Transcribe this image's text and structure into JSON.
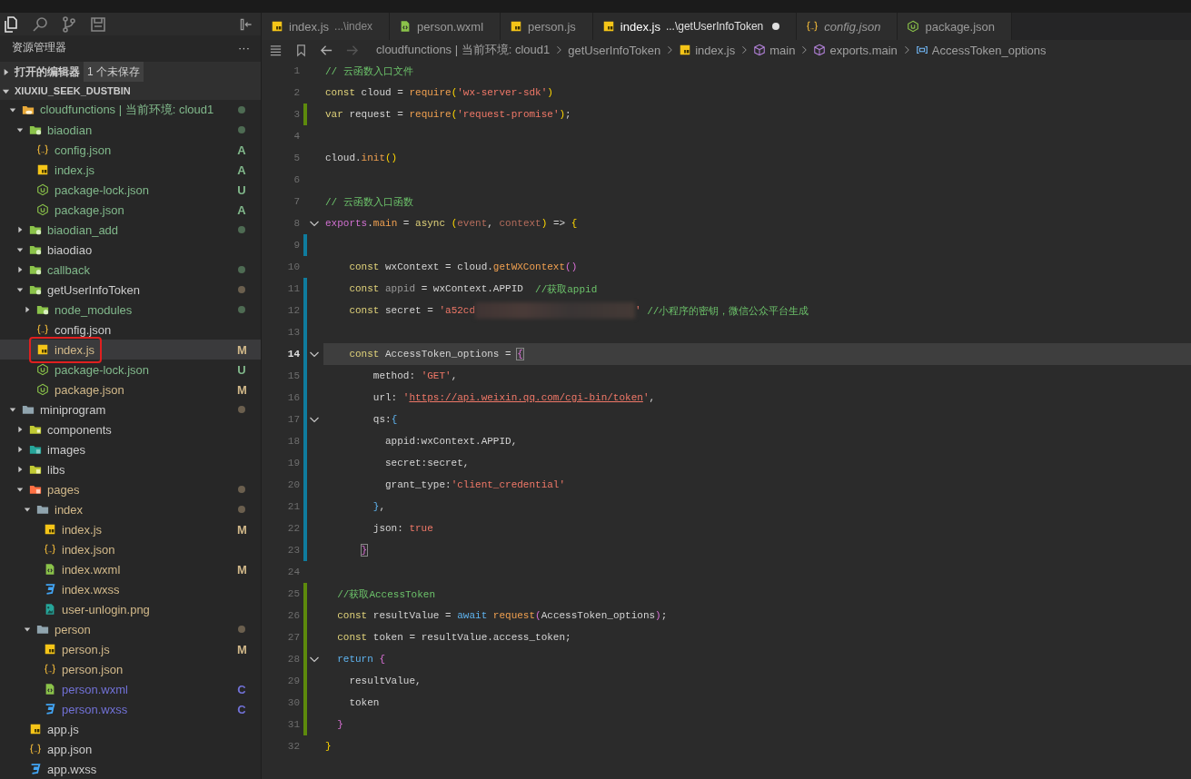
{
  "activity": [
    {
      "kind": "files",
      "selected": true
    },
    {
      "kind": "search",
      "selected": false
    },
    {
      "kind": "source-control",
      "selected": false
    },
    {
      "kind": "storage",
      "selected": false
    }
  ],
  "sidebar": {
    "title": "资源管理器",
    "more": "···",
    "open_editors": {
      "label": "打开的编辑器",
      "badge": "1 个未保存",
      "expanded": false
    },
    "project": {
      "label": "XIUXIU_SEEK_DUSTBIN",
      "expanded": true
    },
    "tree": [
      {
        "name": "cloudfunctions | 当前环境: cloud1",
        "kind": "folder-cloud",
        "color": "#81b88b",
        "dot": {
          "color": "#4e6b53"
        },
        "expanded": true,
        "selected": false,
        "children": [
          {
            "name": "biaodian",
            "kind": "folder-green",
            "color": "#81b88b",
            "dot": {
              "color": "#4e6b53"
            },
            "expanded": true,
            "selected": false,
            "children": [
              {
                "name": "config.json",
                "kind": "json",
                "color": "#81b88b",
                "badge": "A",
                "selected": false
              },
              {
                "name": "index.js",
                "kind": "js",
                "color": "#81b88b",
                "badge": "A",
                "selected": false
              },
              {
                "name": "package-lock.json",
                "kind": "node",
                "color": "#81b88b",
                "badge": "U",
                "selected": false
              },
              {
                "name": "package.json",
                "kind": "node",
                "color": "#81b88b",
                "badge": "A",
                "selected": false
              }
            ]
          },
          {
            "name": "biaodian_add",
            "kind": "folder-green",
            "color": "#81b88b",
            "dot": {
              "color": "#4e6b53"
            },
            "expanded": false,
            "selected": false
          },
          {
            "name": "biaodiao",
            "kind": "folder-green",
            "color": "#cccccc",
            "expanded": true,
            "selected": false
          },
          {
            "name": "callback",
            "kind": "folder-green",
            "color": "#81b88b",
            "dot": {
              "color": "#4e6b53"
            },
            "expanded": false,
            "selected": false
          },
          {
            "name": "getUserInfoToken",
            "kind": "folder-green",
            "color": "#cccccc",
            "dot": {
              "color": "#6b5f4e"
            },
            "expanded": true,
            "selected": false,
            "children": [
              {
                "name": "node_modules",
                "kind": "folder-green",
                "color": "#81b88b",
                "dot": {
                  "color": "#4e6b53"
                },
                "expanded": false,
                "selected": false
              },
              {
                "name": "config.json",
                "kind": "json",
                "color": "#cccccc",
                "selected": false
              },
              {
                "name": "index.js",
                "kind": "js",
                "color": "#d2b98a",
                "badge": "M",
                "selected": true
              },
              {
                "name": "package-lock.json",
                "kind": "node",
                "color": "#81b88b",
                "badge": "U",
                "selected": false
              },
              {
                "name": "package.json",
                "kind": "node",
                "color": "#d2b98a",
                "badge": "M",
                "selected": false
              }
            ]
          }
        ]
      },
      {
        "name": "miniprogram",
        "kind": "folder-grey",
        "color": "#cccccc",
        "dot": {
          "color": "#6b5f4e"
        },
        "expanded": true,
        "selected": false,
        "children": [
          {
            "name": "components",
            "kind": "folder-components",
            "color": "#cccccc",
            "expanded": false,
            "selected": false
          },
          {
            "name": "images",
            "kind": "folder-images",
            "color": "#cccccc",
            "expanded": false,
            "selected": false
          },
          {
            "name": "libs",
            "kind": "folder-libs",
            "color": "#cccccc",
            "expanded": false,
            "selected": false
          },
          {
            "name": "pages",
            "kind": "folder-pages",
            "color": "#d2b98a",
            "dot": {
              "color": "#6b5f4e"
            },
            "expanded": true,
            "selected": false,
            "children": [
              {
                "name": "index",
                "kind": "folder-grey",
                "color": "#d2b98a",
                "dot": {
                  "color": "#6b5f4e"
                },
                "expanded": true,
                "selected": false,
                "children": [
                  {
                    "name": "index.js",
                    "kind": "js",
                    "color": "#d2b98a",
                    "badge": "M",
                    "selected": false
                  },
                  {
                    "name": "index.json",
                    "kind": "json",
                    "color": "#d2b98a",
                    "selected": false
                  },
                  {
                    "name": "index.wxml",
                    "kind": "wxml",
                    "color": "#d2b98a",
                    "badge": "M",
                    "selected": false
                  },
                  {
                    "name": "index.wxss",
                    "kind": "wxss",
                    "color": "#d2b98a",
                    "selected": false
                  },
                  {
                    "name": "user-unlogin.png",
                    "kind": "image",
                    "color": "#d2b98a",
                    "selected": false
                  }
                ]
              },
              {
                "name": "person",
                "kind": "folder-grey",
                "color": "#d2b98a",
                "dot": {
                  "color": "#6b5f4e"
                },
                "expanded": true,
                "selected": false,
                "children": [
                  {
                    "name": "person.js",
                    "kind": "js",
                    "color": "#d2b98a",
                    "badge": "M",
                    "selected": false
                  },
                  {
                    "name": "person.json",
                    "kind": "json",
                    "color": "#d2b98a",
                    "selected": false
                  },
                  {
                    "name": "person.wxml",
                    "kind": "wxml",
                    "color": "#7171d6",
                    "badge": "C",
                    "selected": false
                  },
                  {
                    "name": "person.wxss",
                    "kind": "wxss",
                    "color": "#7171d6",
                    "badge": "C",
                    "selected": false
                  }
                ]
              }
            ]
          },
          {
            "name": "app.js",
            "kind": "js",
            "color": "#cccccc",
            "selected": false
          },
          {
            "name": "app.json",
            "kind": "json",
            "color": "#cccccc",
            "selected": false
          },
          {
            "name": "app.wxss",
            "kind": "wxss",
            "color": "#cccccc",
            "selected": false
          }
        ]
      }
    ]
  },
  "tabs": [
    {
      "label": "index.js",
      "path": "...\\index",
      "kind": "js",
      "selected": false,
      "dirty": false,
      "preview": false
    },
    {
      "label": "person.wxml",
      "kind": "wxml",
      "selected": false,
      "dirty": false,
      "preview": false
    },
    {
      "label": "person.js",
      "kind": "js",
      "selected": false,
      "dirty": false,
      "preview": false
    },
    {
      "label": "index.js",
      "path": "...\\getUserInfoToken",
      "kind": "js",
      "selected": true,
      "dirty": true,
      "preview": false
    },
    {
      "label": "config.json",
      "kind": "json",
      "selected": false,
      "dirty": false,
      "preview": true
    },
    {
      "label": "package.json",
      "kind": "node",
      "selected": false,
      "dirty": false,
      "preview": false
    }
  ],
  "nav": {
    "back_disabled": false,
    "forward_disabled": true
  },
  "breadcrumb": [
    {
      "label": "cloudfunctions | 当前环境: cloud1"
    },
    {
      "label": "getUserInfoToken"
    },
    {
      "label": "index.js",
      "kind": "js"
    },
    {
      "label": "main",
      "kind": "method"
    },
    {
      "label": "exports.main",
      "kind": "method"
    },
    {
      "label": "AccessToken_options",
      "kind": "field"
    }
  ],
  "lines": [
    {
      "number": "1",
      "current": false,
      "fold": false,
      "tokens": [
        {
          "kind": "comment",
          "text": "// 云函数入口文件"
        }
      ]
    },
    {
      "number": "2",
      "current": false,
      "fold": false,
      "tokens": [
        {
          "kind": "kw",
          "text": "const"
        },
        {
          "kind": "plain",
          "text": " cloud = "
        },
        {
          "kind": "fn",
          "text": "require"
        },
        {
          "kind": "brace",
          "text": "("
        },
        {
          "kind": "str",
          "text": "'wx-server-sdk'"
        },
        {
          "kind": "brace",
          "text": ")"
        }
      ]
    },
    {
      "number": "3",
      "current": false,
      "fold": false,
      "change": {
        "color": "#5d8a0c"
      },
      "tokens": [
        {
          "kind": "kw",
          "text": "var"
        },
        {
          "kind": "plain",
          "text": " request = "
        },
        {
          "kind": "fn",
          "text": "require"
        },
        {
          "kind": "brace",
          "text": "("
        },
        {
          "kind": "str",
          "text": "'request-promise'"
        },
        {
          "kind": "brace",
          "text": ")"
        },
        {
          "kind": "plain",
          "text": ";"
        }
      ]
    },
    {
      "number": "4",
      "current": false,
      "fold": false
    },
    {
      "number": "5",
      "current": false,
      "fold": false,
      "tokens": [
        {
          "kind": "plain",
          "text": "cloud."
        },
        {
          "kind": "fn",
          "text": "init"
        },
        {
          "kind": "brace",
          "text": "()"
        }
      ]
    },
    {
      "number": "6",
      "current": false,
      "fold": false
    },
    {
      "number": "7",
      "current": false,
      "fold": false,
      "tokens": [
        {
          "kind": "comment",
          "text": "// 云函数入口函数"
        }
      ]
    },
    {
      "number": "8",
      "current": false,
      "fold": true,
      "tokens": [
        {
          "kind": "magenta",
          "text": "exports"
        },
        {
          "kind": "plain",
          "text": "."
        },
        {
          "kind": "fn",
          "text": "main"
        },
        {
          "kind": "plain",
          "text": " = "
        },
        {
          "kind": "kw",
          "text": "async "
        },
        {
          "kind": "brace",
          "text": "("
        },
        {
          "kind": "param",
          "text": "event"
        },
        {
          "kind": "plain",
          "text": ", "
        },
        {
          "kind": "param",
          "text": "context"
        },
        {
          "kind": "brace",
          "text": ")"
        },
        {
          "kind": "plain",
          "text": " => "
        },
        {
          "kind": "brace",
          "text": "{"
        }
      ]
    },
    {
      "number": "9",
      "current": false,
      "fold": false,
      "change": {
        "color": "#0f7c9e"
      }
    },
    {
      "number": "10",
      "current": false,
      "fold": false,
      "tokens": [
        {
          "kind": "kw",
          "text": "    const"
        },
        {
          "kind": "plain",
          "text": " wxContext = cloud."
        },
        {
          "kind": "fn",
          "text": "getWXContext"
        },
        {
          "kind": "pink",
          "text": "()"
        }
      ]
    },
    {
      "number": "11",
      "current": false,
      "fold": false,
      "change": {
        "color": "#0f7c9e"
      },
      "tokens": [
        {
          "kind": "kw",
          "text": "    const"
        },
        {
          "kind": "dim",
          "text": " appid"
        },
        {
          "kind": "plain",
          "text": " = wxContext.APPID  "
        },
        {
          "kind": "comment",
          "text": "//获取appid"
        }
      ]
    },
    {
      "number": "12",
      "current": false,
      "fold": false,
      "change": {
        "color": "#0f7c9e"
      },
      "tokens": [
        {
          "kind": "kw",
          "text": "    const"
        },
        {
          "kind": "plain",
          "text": " secret = "
        },
        {
          "kind": "str",
          "text": "'a52cd"
        },
        {
          "kind": "redacted"
        },
        {
          "kind": "str",
          "text": "'"
        },
        {
          "kind": "comment",
          "text": " //小程序的密钥，微信公众平台生成"
        }
      ]
    },
    {
      "number": "13",
      "current": false,
      "fold": false,
      "change": {
        "color": "#0f7c9e"
      }
    },
    {
      "number": "14",
      "current": true,
      "fold": true,
      "change": {
        "color": "#0f7c9e"
      },
      "tokens": [
        {
          "kind": "kw",
          "text": "    const"
        },
        {
          "kind": "plain",
          "text": " AccessToken_options = "
        },
        {
          "kind": "match",
          "text": "{"
        }
      ]
    },
    {
      "number": "15",
      "current": false,
      "fold": false,
      "change": {
        "color": "#0f7c9e"
      },
      "tokens": [
        {
          "kind": "plain",
          "text": "        method: "
        },
        {
          "kind": "str",
          "text": "'GET'"
        },
        {
          "kind": "plain",
          "text": ","
        }
      ]
    },
    {
      "number": "16",
      "current": false,
      "fold": false,
      "change": {
        "color": "#0f7c9e"
      },
      "tokens": [
        {
          "kind": "plain",
          "text": "        url: "
        },
        {
          "kind": "str",
          "text": "'"
        },
        {
          "kind": "link",
          "text": "https://api.weixin.qq.com/cgi-bin/token"
        },
        {
          "kind": "str",
          "text": "'"
        },
        {
          "kind": "plain",
          "text": ","
        }
      ]
    },
    {
      "number": "17",
      "current": false,
      "fold": true,
      "change": {
        "color": "#0f7c9e"
      },
      "tokens": [
        {
          "kind": "plain",
          "text": "        qs:"
        },
        {
          "kind": "blue",
          "text": "{"
        }
      ]
    },
    {
      "number": "18",
      "current": false,
      "fold": false,
      "change": {
        "color": "#0f7c9e"
      },
      "tokens": [
        {
          "kind": "plain",
          "text": "          appid:wxContext.APPID,"
        }
      ]
    },
    {
      "number": "19",
      "current": false,
      "fold": false,
      "change": {
        "color": "#0f7c9e"
      },
      "tokens": [
        {
          "kind": "plain",
          "text": "          secret:secret,"
        }
      ]
    },
    {
      "number": "20",
      "current": false,
      "fold": false,
      "change": {
        "color": "#0f7c9e"
      },
      "tokens": [
        {
          "kind": "plain",
          "text": "          grant_type:"
        },
        {
          "kind": "str",
          "text": "'client_credential'"
        }
      ]
    },
    {
      "number": "21",
      "current": false,
      "fold": false,
      "change": {
        "color": "#0f7c9e"
      },
      "tokens": [
        {
          "kind": "blue",
          "text": "        }"
        },
        {
          "kind": "plain",
          "text": ","
        }
      ]
    },
    {
      "number": "22",
      "current": false,
      "fold": false,
      "change": {
        "color": "#0f7c9e"
      },
      "tokens": [
        {
          "kind": "plain",
          "text": "        json: "
        },
        {
          "kind": "str",
          "text": "true"
        }
      ]
    },
    {
      "number": "23",
      "current": false,
      "fold": false,
      "change": {
        "color": "#0f7c9e"
      },
      "tokens": [
        {
          "kind": "match",
          "text": "      }"
        }
      ]
    },
    {
      "number": "24",
      "current": false,
      "fold": false
    },
    {
      "number": "25",
      "current": false,
      "fold": false,
      "change": {
        "color": "#5d8a0c"
      },
      "tokens": [
        {
          "kind": "comment",
          "text": "  //获取AccessToken"
        }
      ]
    },
    {
      "number": "26",
      "current": false,
      "fold": false,
      "change": {
        "color": "#5d8a0c"
      },
      "tokens": [
        {
          "kind": "kw",
          "text": "  const"
        },
        {
          "kind": "plain",
          "text": " resultValue = "
        },
        {
          "kind": "blue",
          "text": "await "
        },
        {
          "kind": "fn",
          "text": "request"
        },
        {
          "kind": "pink",
          "text": "("
        },
        {
          "kind": "plain",
          "text": "AccessToken_options"
        },
        {
          "kind": "pink",
          "text": ")"
        },
        {
          "kind": "plain",
          "text": ";"
        }
      ]
    },
    {
      "number": "27",
      "current": false,
      "fold": false,
      "change": {
        "color": "#5d8a0c"
      },
      "tokens": [
        {
          "kind": "kw",
          "text": "  const"
        },
        {
          "kind": "plain",
          "text": " token = resultValue.access_token;"
        }
      ]
    },
    {
      "number": "28",
      "current": false,
      "fold": true,
      "change": {
        "color": "#5d8a0c"
      },
      "tokens": [
        {
          "kind": "blue",
          "text": "  return "
        },
        {
          "kind": "pink",
          "text": "{"
        }
      ]
    },
    {
      "number": "29",
      "current": false,
      "fold": false,
      "change": {
        "color": "#5d8a0c"
      },
      "tokens": [
        {
          "kind": "plain",
          "text": "    resultValue,"
        }
      ]
    },
    {
      "number": "30",
      "current": false,
      "fold": false,
      "change": {
        "color": "#5d8a0c"
      },
      "tokens": [
        {
          "kind": "plain",
          "text": "    token"
        }
      ]
    },
    {
      "number": "31",
      "current": false,
      "fold": false,
      "change": {
        "color": "#5d8a0c"
      },
      "tokens": [
        {
          "kind": "pink",
          "text": "  }"
        }
      ]
    },
    {
      "number": "32",
      "current": false,
      "fold": false,
      "tokens": [
        {
          "kind": "brace",
          "text": "}"
        }
      ]
    }
  ]
}
